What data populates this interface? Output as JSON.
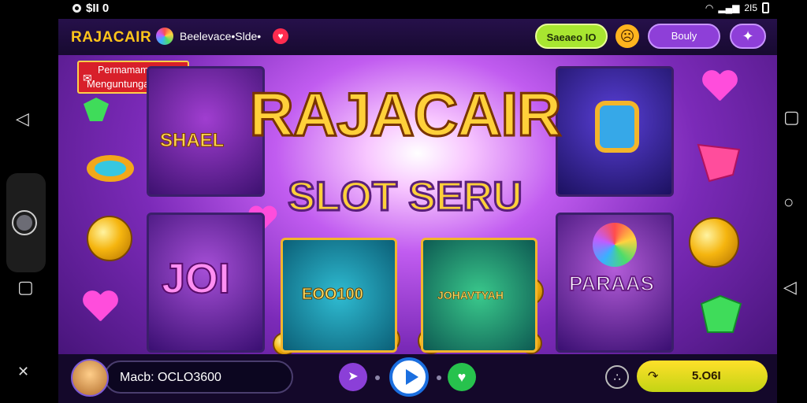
{
  "status_bar": {
    "left_text": "$II 0",
    "right_text": "2I5"
  },
  "header": {
    "brand": "RAJACAIR",
    "tagline": "Beelevace•Slde•",
    "green_button": "Saeaeo IO",
    "purple_button": "Bouly",
    "star_icon": "sparkle-icon"
  },
  "promo_badge": {
    "line1": "Permamam",
    "line2": "Menguntungan"
  },
  "headline": {
    "title": "RAJACAIR",
    "subtitle": "SLOT SERU"
  },
  "tiles": {
    "shaed": "SHAEL",
    "joi": "JOI",
    "bonus1": "EOO100",
    "bonus2": "JOHAVTYAH",
    "paraas": "PARAAS"
  },
  "bottom_bar": {
    "balance": "Macb: OCLO3600",
    "cta_label": "5.O6I",
    "cta_icon": "arrow-icon"
  },
  "colors": {
    "brand": "#ffc51a",
    "accent_green": "#a8e630",
    "accent_purple": "#8e3fd8",
    "cta": "#ffe02a"
  }
}
